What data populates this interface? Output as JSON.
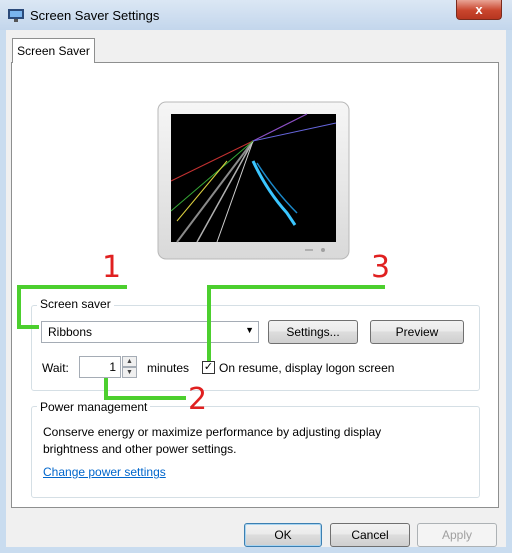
{
  "window": {
    "title": "Screen Saver Settings",
    "close_glyph": "x"
  },
  "tabs": [
    {
      "label": "Screen Saver"
    }
  ],
  "screen_saver": {
    "group_label": "Screen saver",
    "selected": "Ribbons",
    "settings_label": "Settings...",
    "preview_label": "Preview",
    "wait_label": "Wait:",
    "wait_value": "1",
    "minutes_label": "minutes",
    "resume_label": "On resume, display logon screen",
    "resume_checked": true
  },
  "power": {
    "group_label": "Power management",
    "description": "Conserve energy or maximize performance by adjusting display brightness and other power settings.",
    "link_label": "Change power settings"
  },
  "buttons": {
    "ok": "OK",
    "cancel": "Cancel",
    "apply": "Apply"
  },
  "annotations": [
    {
      "label": "1"
    },
    {
      "label": "2"
    },
    {
      "label": "3"
    }
  ],
  "colors": {
    "annotation_text": "#e02020",
    "annotation_line": "#4ccf2e",
    "link": "#0066cc"
  }
}
